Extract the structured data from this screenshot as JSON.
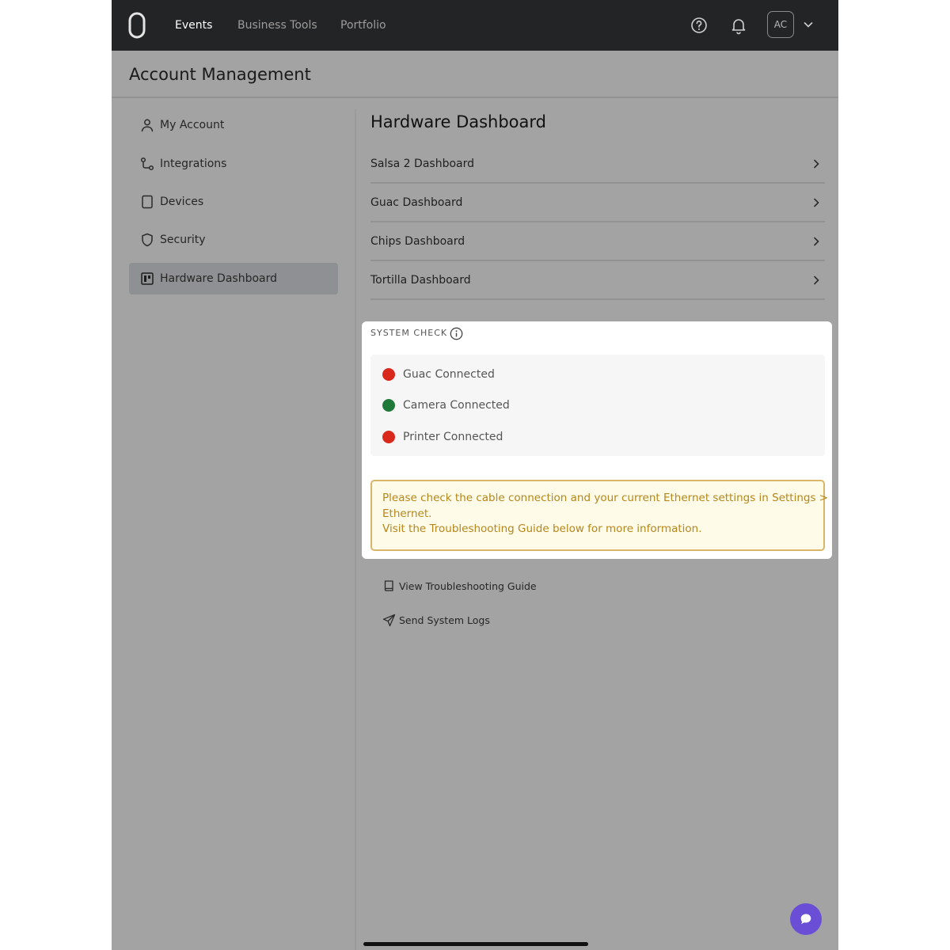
{
  "nav": {
    "logo": "logo-icon",
    "links": [
      {
        "label": "Events"
      },
      {
        "label": "Business Tools"
      },
      {
        "label": "Portfolio"
      }
    ],
    "avatar_initials": "AC"
  },
  "page_title": "Account Management",
  "sidebar": {
    "items": [
      {
        "label": "My Account",
        "icon": "person-icon"
      },
      {
        "label": "Integrations",
        "icon": "integrations-icon"
      },
      {
        "label": "Devices",
        "icon": "device-icon"
      },
      {
        "label": "Security",
        "icon": "shield-icon"
      },
      {
        "label": "Hardware Dashboard",
        "icon": "dashboard-icon",
        "active": true
      }
    ]
  },
  "main": {
    "title": "Hardware Dashboard",
    "dashboards": [
      {
        "label": "Salsa 2 Dashboard"
      },
      {
        "label": "Guac Dashboard"
      },
      {
        "label": "Chips Dashboard"
      },
      {
        "label": "Tortilla Dashboard"
      }
    ],
    "system_check": {
      "heading": "SYSTEM CHECK",
      "checks": [
        {
          "label": "Guac Connected",
          "status": "error"
        },
        {
          "label": "Camera Connected",
          "status": "ok"
        },
        {
          "label": "Printer Connected",
          "status": "error"
        }
      ],
      "alert": {
        "line1": "Please check the cable connection and your current Ethernet settings in Settings >",
        "line2": "Ethernet.",
        "line3": "Visit the Troubleshooting Guide below for more information."
      }
    },
    "links": [
      {
        "label": "View Troubleshooting Guide",
        "icon": "book-icon"
      },
      {
        "label": "Send System Logs",
        "icon": "send-icon"
      }
    ]
  },
  "colors": {
    "status_error": "#d9291c",
    "status_ok": "#1f7a3a",
    "chat_button": "#6a4ed6",
    "alert_text": "#b5861b"
  }
}
